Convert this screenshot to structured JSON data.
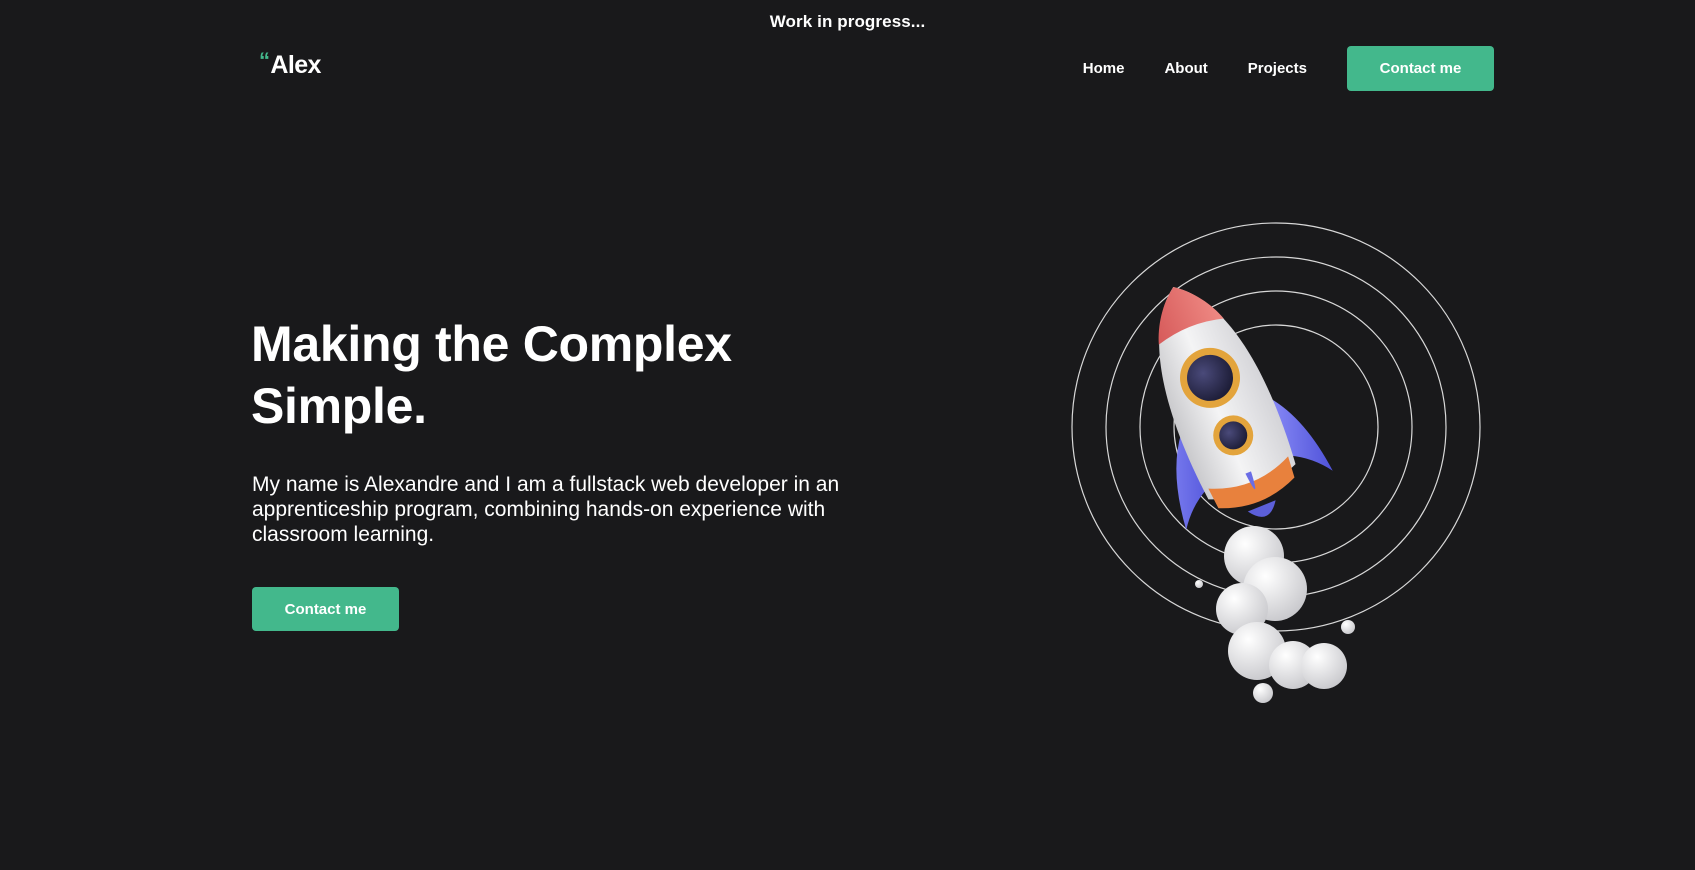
{
  "banner": {
    "text": "Work in progress..."
  },
  "logo": {
    "quote": "“",
    "name": "Alex"
  },
  "nav": {
    "items": [
      {
        "label": "Home"
      },
      {
        "label": "About"
      },
      {
        "label": "Projects"
      }
    ],
    "contact_label": "Contact me"
  },
  "hero": {
    "title_line1": "Making the Complex",
    "title_line2": "Simple.",
    "description": "My name is Alexandre and I am a fullstack web developer in an apprenticeship program, combining hands-on experience with classroom learning.",
    "contact_label": "Contact me"
  },
  "colors": {
    "background": "#19191b",
    "accent": "#43b88c",
    "text": "#ffffff"
  },
  "icons": {
    "illustration": "rocket-icon"
  }
}
